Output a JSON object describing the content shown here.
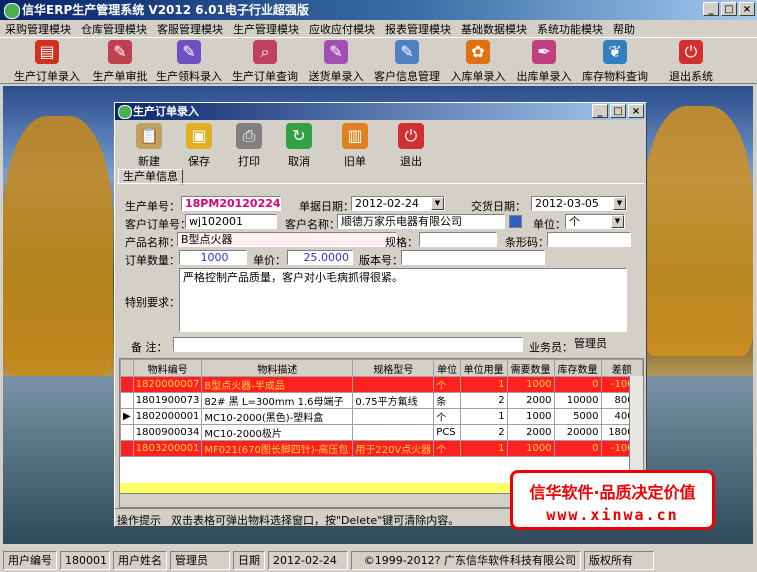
{
  "app": {
    "title": "信华ERP生产管理系统  V2012  6.01电子行业超强版"
  },
  "menu": [
    "采购管理模块",
    "仓库管理模块",
    "客服管理模块",
    "生产管理模块",
    "应收应付模块",
    "报表管理模块",
    "基础数据模块",
    "系统功能模块",
    "帮助"
  ],
  "toolbar": [
    {
      "label": "生产订单录入",
      "icon": "document-pdf-icon",
      "color": "#d03020"
    },
    {
      "label": "生产单审批",
      "icon": "pen-document-icon",
      "color": "#c04050"
    },
    {
      "label": "生产领料录入",
      "icon": "pen-document-icon",
      "color": "#7050c0"
    },
    {
      "label": "生产订单查询",
      "icon": "document-search-icon",
      "color": "#c04060"
    },
    {
      "label": "送货单录入",
      "icon": "document-pen-icon",
      "color": "#a050b0"
    },
    {
      "label": "客户信息管理",
      "icon": "document-edit-icon",
      "color": "#5080c0"
    },
    {
      "label": "入库单录入",
      "icon": "flower-icon",
      "color": "#e07010"
    },
    {
      "label": "出库单录入",
      "icon": "pen-icon",
      "color": "#c04080"
    },
    {
      "label": "库存物料查询",
      "icon": "feather-icon",
      "color": "#3080c0"
    },
    {
      "label": "退出系统",
      "icon": "exit-icon",
      "color": "#d03030"
    }
  ],
  "child": {
    "title": "生产订单录入",
    "tools": [
      {
        "label": "新建",
        "icon": "clipboard-icon",
        "color": "#c0a060"
      },
      {
        "label": "保存",
        "icon": "save-icon",
        "color": "#e0b020"
      },
      {
        "label": "打印",
        "icon": "printer-icon",
        "color": "#808080"
      },
      {
        "label": "取消",
        "icon": "cancel-icon",
        "color": "#30a040"
      },
      {
        "label": "旧单",
        "icon": "books-icon",
        "color": "#e08020"
      },
      {
        "label": "退出",
        "icon": "exit-icon",
        "color": "#d03030"
      }
    ],
    "tab": "生产单信息",
    "form": {
      "order_no_label": "生产单号：",
      "order_no": "18PM20120224001",
      "doc_date_label": "单据日期：",
      "doc_date": "2012-02-24",
      "delivery_label": "交货日期：",
      "delivery_date": "2012-03-05",
      "cust_order_label": "客户订单号：",
      "cust_order": "wj102001",
      "cust_name_label": "客户名称：",
      "cust_name": "顺德万家乐电器有限公司",
      "unit_label": "单位：",
      "unit": "个",
      "product_label": "产品名称：",
      "product": "B型点火器",
      "spec_label": "规格：",
      "spec": "",
      "barcode_label": "条形码：",
      "barcode": "",
      "qty_label": "订单数量：",
      "qty": "1000",
      "price_label": "单价：",
      "price": "25.0000",
      "version_label": "版本号：",
      "version": "",
      "special_label": "特别要求：",
      "special": "严格控制产品质量，客户对小毛病抓得很紧。",
      "remark_label": "备 注：",
      "remark": "",
      "sales_label": "业务员：",
      "sales": "管理员"
    },
    "grid": {
      "headers": [
        "物料编号",
        "物料描述",
        "规格型号",
        "单位",
        "单位用量",
        "需要数量",
        "库存数量",
        "差额"
      ],
      "rows": [
        {
          "cells": [
            "1820000007",
            "B型点火器-半成品",
            "",
            "个",
            "1",
            "1000",
            "0",
            "-1000"
          ],
          "red": true
        },
        {
          "cells": [
            "1801900073",
            "82#  黑 L=300mm 1.6母端子",
            "0.75平方氟线",
            "条",
            "2",
            "2000",
            "10000",
            "8000"
          ],
          "red": false
        },
        {
          "cells": [
            "1802000001",
            "MC10-2000(黑色)-塑料盒",
            "",
            "个",
            "1",
            "1000",
            "5000",
            "4000"
          ],
          "red": false
        },
        {
          "cells": [
            "1800900034",
            "MC10-2000极片",
            "",
            "PCS",
            "2",
            "2000",
            "20000",
            "18000"
          ],
          "red": false
        },
        {
          "cells": [
            "1803200001",
            "MF021(670图长脚四针)-高压包",
            "用于220V点火器",
            "个",
            "1",
            "1000",
            "0",
            "-1000"
          ],
          "red": true
        }
      ]
    },
    "hint_label": "操作提示",
    "hint": "双击表格可弹出物料选择窗口，按\"Delete\"键可清除内容。"
  },
  "ad": {
    "line1": "信华软件·品质决定价值",
    "line2": "www.xinwa.cn"
  },
  "status": [
    "用户编号",
    "180001",
    "用户姓名",
    "管理员",
    "日期",
    "2012-02-24",
    "©1999-2012?  广东信华软件科技有限公司",
    "版权所有"
  ]
}
